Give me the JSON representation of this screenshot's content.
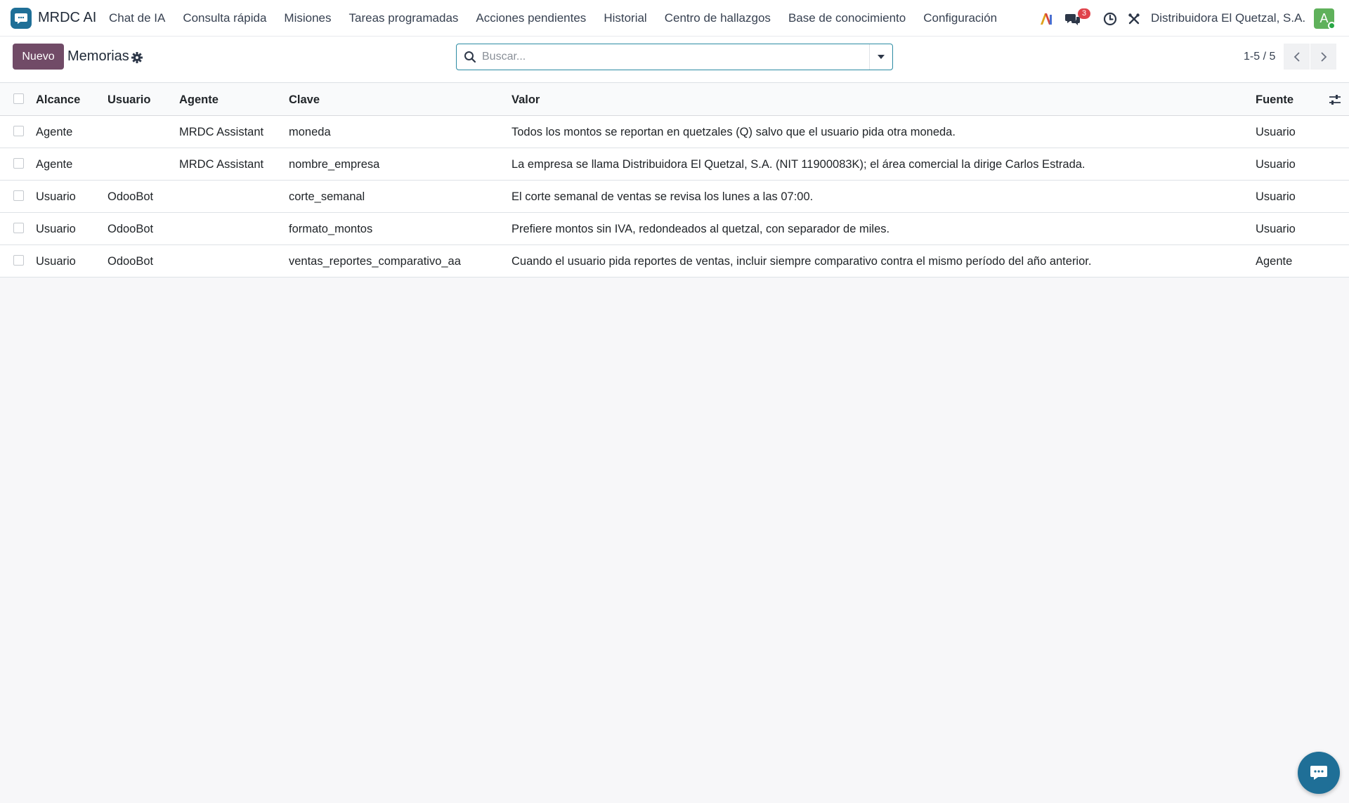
{
  "navbar": {
    "app_name": "MRDC AI",
    "menu": [
      "Chat de IA",
      "Consulta rápida",
      "Misiones",
      "Tareas programadas",
      "Acciones pendientes",
      "Historial",
      "Centro de hallazgos",
      "Base de conocimiento",
      "Configuración"
    ],
    "messages_badge": "3",
    "company": "Distribuidora El Quetzal, S.A.",
    "avatar_letter": "A",
    "icons": [
      "ai-logo-icon",
      "chat-bubbles-icon",
      "clock-icon",
      "debug-tools-icon"
    ]
  },
  "control": {
    "new_button": "Nuevo",
    "title": "Memorias",
    "search_placeholder": "Buscar...",
    "pager": "1-5 / 5"
  },
  "table": {
    "headers": {
      "alcance": "Alcance",
      "usuario": "Usuario",
      "agente": "Agente",
      "clave": "Clave",
      "valor": "Valor",
      "fuente": "Fuente"
    },
    "rows": [
      {
        "alcance": "Agente",
        "usuario": "",
        "agente": "MRDC Assistant",
        "clave": "moneda",
        "valor": "Todos los montos se reportan en quetzales (Q) salvo que el usuario pida otra moneda.",
        "fuente": "Usuario"
      },
      {
        "alcance": "Agente",
        "usuario": "",
        "agente": "MRDC Assistant",
        "clave": "nombre_empresa",
        "valor": "La empresa se llama Distribuidora El Quetzal, S.A. (NIT 11900083K); el área comercial la dirige Carlos Estrada.",
        "fuente": "Usuario"
      },
      {
        "alcance": "Usuario",
        "usuario": "OdooBot",
        "agente": "",
        "clave": "corte_semanal",
        "valor": "El corte semanal de ventas se revisa los lunes a las 07:00.",
        "fuente": "Usuario"
      },
      {
        "alcance": "Usuario",
        "usuario": "OdooBot",
        "agente": "",
        "clave": "formato_montos",
        "valor": "Prefiere montos sin IVA, redondeados al quetzal, con separador de miles.",
        "fuente": "Usuario"
      },
      {
        "alcance": "Usuario",
        "usuario": "OdooBot",
        "agente": "",
        "clave": "ventas_reportes_comparativo_aa",
        "valor": "Cuando el usuario pida reportes de ventas, incluir siempre comparativo contra el mismo período del año anterior.",
        "fuente": "Agente"
      }
    ]
  },
  "colors": {
    "brand": "#714b67",
    "app_icon": "#1f6f97",
    "search_border": "#2b8ba3",
    "badge": "#e0434b",
    "avatar": "#5fb15b"
  }
}
